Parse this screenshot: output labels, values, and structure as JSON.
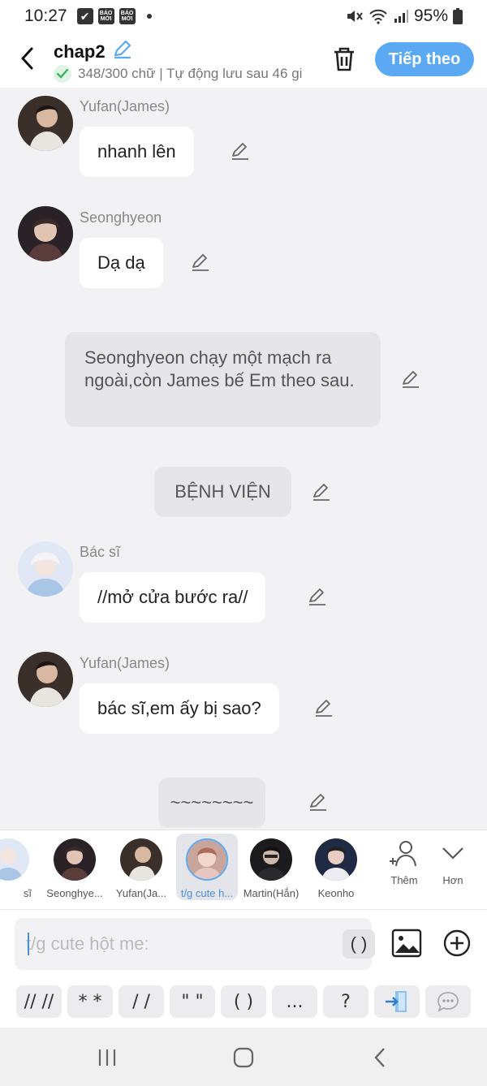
{
  "status_bar": {
    "time": "10:27",
    "badge_1": "BÁO MỚI",
    "badge_2": "BÁO MỚI",
    "battery": "95%"
  },
  "header": {
    "title": "chap2",
    "subtitle": "348/300 chữ | Tự động lưu sau 46 gi",
    "next_label": "Tiếp theo"
  },
  "messages": [
    {
      "type": "char",
      "speaker": "Yufan(James)",
      "text": "nhanh lên"
    },
    {
      "type": "char",
      "speaker": "Seonghyeon",
      "text": "Dạ dạ"
    },
    {
      "type": "narration",
      "text": "Seonghyeon chạy một mạch ra ngoài,còn James bế Em theo sau."
    },
    {
      "type": "narration",
      "text": "BỆNH VIỆN"
    },
    {
      "type": "char",
      "speaker": "Bác sĩ",
      "text": "//mở cửa bước ra//"
    },
    {
      "type": "char",
      "speaker": "Yufan(James)",
      "text": "bác sĩ,em ấy bị sao?"
    },
    {
      "type": "narration",
      "text": "~~~~~~~~"
    }
  ],
  "characters": [
    {
      "name": "sĩ"
    },
    {
      "name": "Seonghye..."
    },
    {
      "name": "Yufan(Ja..."
    },
    {
      "name": "t/g cute h..."
    },
    {
      "name": "Martin(Hắn)"
    },
    {
      "name": "Keonho"
    }
  ],
  "tools": {
    "add_label": "Thêm",
    "more_label": "Hơn"
  },
  "input": {
    "placeholder": "t/g cute hột me:",
    "paren_label": "( )"
  },
  "quick_keys": [
    "// //",
    "* *",
    "/ /",
    "\" \"",
    "( )",
    "...",
    "?"
  ],
  "colors": {
    "accent": "#5aa9f2",
    "bubble": "#ffffff",
    "narration": "#e6e6e8",
    "background": "#f2f2f4"
  }
}
